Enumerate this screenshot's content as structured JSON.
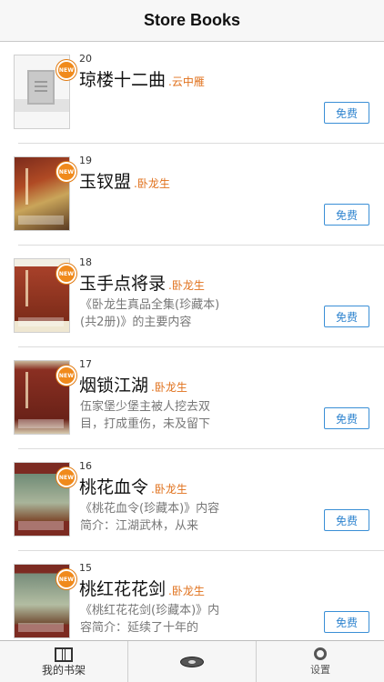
{
  "nav": {
    "title": "Store Books"
  },
  "books": [
    {
      "num": "20",
      "title": "琼楼十二曲",
      "author": ".云中雁",
      "desc": "",
      "button": "免费",
      "badge": "NEW"
    },
    {
      "num": "19",
      "title": "玉钗盟",
      "author": ".卧龙生",
      "desc": "",
      "button": "免费",
      "badge": "NEW"
    },
    {
      "num": "18",
      "title": "玉手点将录",
      "author": ".卧龙生",
      "desc": "《卧龙生真品全集(珍藏本)(共2册)》的主要内容",
      "button": "免费",
      "badge": "NEW"
    },
    {
      "num": "17",
      "title": "烟锁江湖",
      "author": ".卧龙生",
      "desc": "伍家堡少堡主被人挖去双目，打成重伤，未及留下",
      "button": "免费",
      "badge": "NEW"
    },
    {
      "num": "16",
      "title": "桃花血令",
      "author": ".卧龙生",
      "desc": "《桃花血令(珍藏本)》内容简介：江湖武林，从来",
      "button": "免费",
      "badge": "NEW"
    },
    {
      "num": "15",
      "title": "桃红花花剑",
      "author": ".卧龙生",
      "desc": "《桃红花花剑(珍藏本)》内容简介：延续了十年的",
      "button": "免费",
      "badge": "NEW"
    }
  ],
  "tabbar": {
    "bookshelf_label": "我的书架",
    "settings_label": "设置"
  },
  "colors": {
    "accent": "#2f84cf",
    "author": "#e0711c",
    "badge": "#f08a1c"
  }
}
